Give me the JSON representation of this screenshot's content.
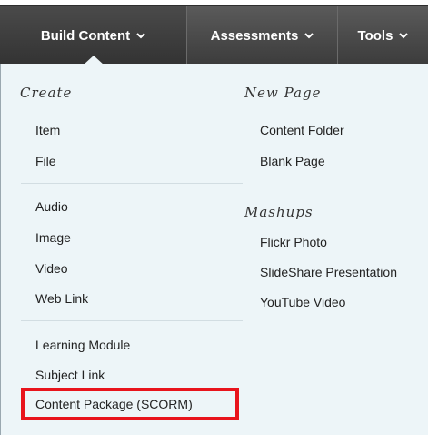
{
  "nav": {
    "tabs": [
      {
        "label": "Build Content",
        "active": true
      },
      {
        "label": "Assessments",
        "active": false
      },
      {
        "label": "Tools",
        "active": false
      }
    ]
  },
  "menu": {
    "create_heading": "Create",
    "create_group1": [
      "Item",
      "File"
    ],
    "create_group2": [
      "Audio",
      "Image",
      "Video",
      "Web Link"
    ],
    "create_group3": [
      "Learning Module",
      "Subject Link",
      "Content Package (SCORM)"
    ],
    "new_page_heading": "New Page",
    "new_page_items": [
      "Content Folder",
      "Blank Page"
    ],
    "mashups_heading": "Mashups",
    "mashups_items": [
      "Flickr Photo",
      "SlideShare Presentation",
      "YouTube Video"
    ]
  },
  "colors": {
    "nav_bg": "#444444",
    "panel_bg": "#edf5f8",
    "highlight": "#e8141c"
  },
  "icons": {
    "tab_chevron": "chevron-down-icon"
  }
}
